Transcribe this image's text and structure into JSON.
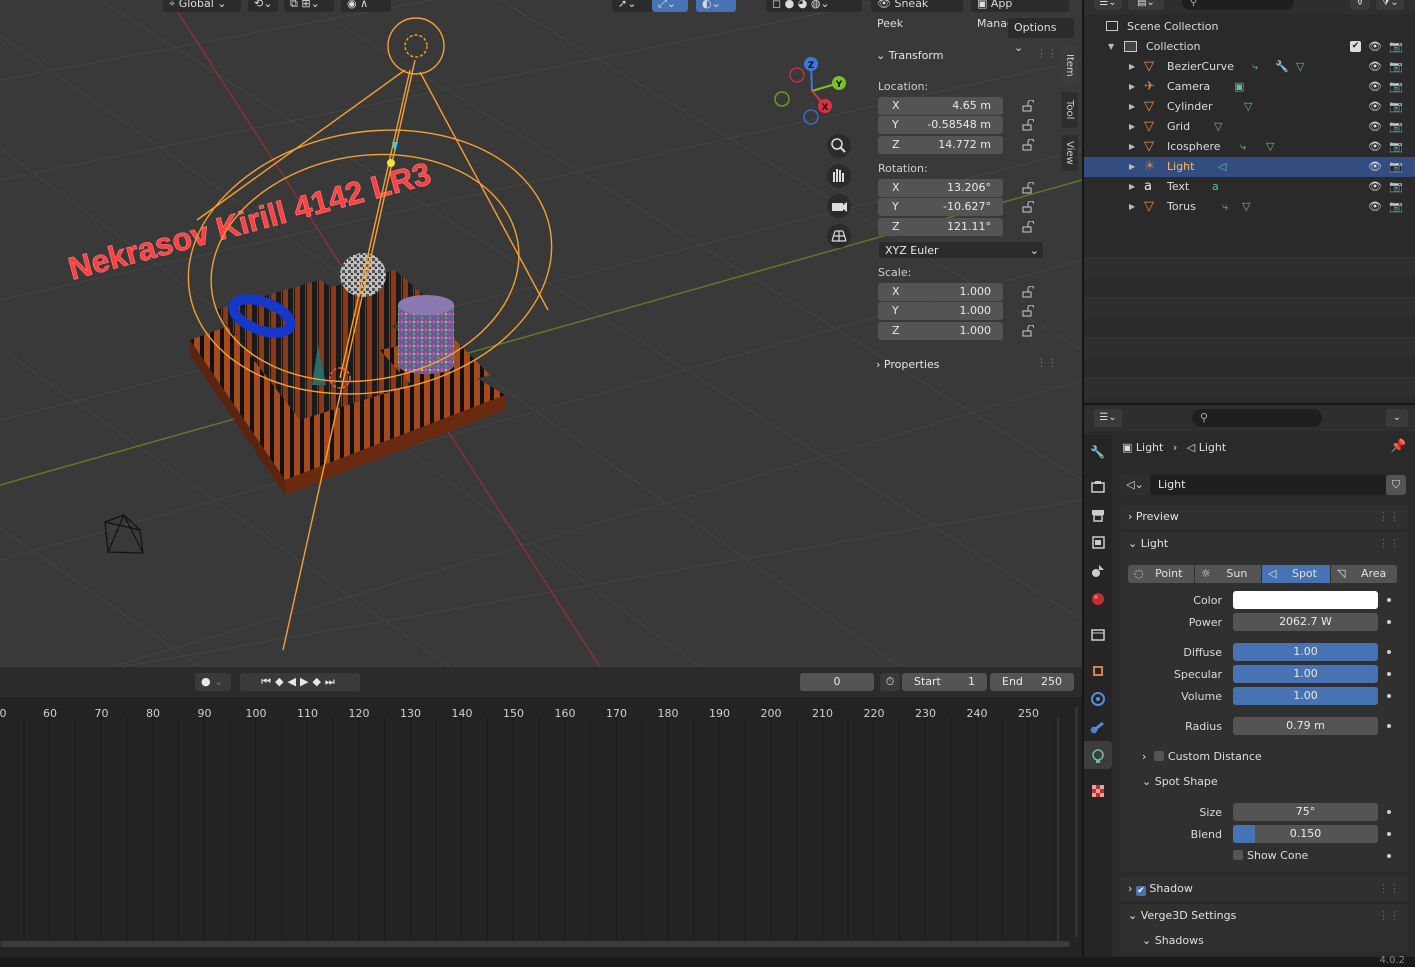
{
  "viewport": {
    "header": {
      "orientation": "Global",
      "sneak_peek": "Sneak Peek",
      "app_manager": "App Manager",
      "options": "Options"
    },
    "scene_text": "Nekrasov Kirill 4142 LR3",
    "gizmo": {
      "x": "X",
      "y": "Y",
      "z": "Z"
    },
    "sidebar_tabs": [
      "Item",
      "Tool",
      "View"
    ],
    "transform": {
      "title": "Transform",
      "location_label": "Location:",
      "location": [
        {
          "axis": "X",
          "value": "4.65 m"
        },
        {
          "axis": "Y",
          "value": "-0.58548 m"
        },
        {
          "axis": "Z",
          "value": "14.772 m"
        }
      ],
      "rotation_label": "Rotation:",
      "rotation": [
        {
          "axis": "X",
          "value": "13.206°"
        },
        {
          "axis": "Y",
          "value": "-10.627°"
        },
        {
          "axis": "Z",
          "value": "121.11°"
        }
      ],
      "rotation_mode": "XYZ Euler",
      "scale_label": "Scale:",
      "scale": [
        {
          "axis": "X",
          "value": "1.000"
        },
        {
          "axis": "Y",
          "value": "1.000"
        },
        {
          "axis": "Z",
          "value": "1.000"
        }
      ]
    },
    "properties_title": "Properties"
  },
  "timeline": {
    "current_frame": "0",
    "start_label": "Start",
    "start": "1",
    "end_label": "End",
    "end": "250",
    "ruler": [
      "0",
      "60",
      "70",
      "80",
      "90",
      "100",
      "110",
      "120",
      "130",
      "140",
      "150",
      "160",
      "170",
      "180",
      "190",
      "200",
      "210",
      "220",
      "230",
      "240",
      "250"
    ]
  },
  "outliner": {
    "scene_collection": "Scene Collection",
    "collection": "Collection",
    "items": [
      {
        "name": "BezierCurve"
      },
      {
        "name": "Camera"
      },
      {
        "name": "Cylinder"
      },
      {
        "name": "Grid"
      },
      {
        "name": "Icosphere"
      },
      {
        "name": "Light"
      },
      {
        "name": "Text"
      },
      {
        "name": "Torus"
      }
    ],
    "selected": "Light"
  },
  "properties": {
    "breadcrumb": [
      "Light",
      "Light"
    ],
    "datablock": "Light",
    "preview": "Preview",
    "light_section": "Light",
    "light_types": [
      "Point",
      "Sun",
      "Spot",
      "Area"
    ],
    "active_type": "Spot",
    "color_label": "Color",
    "color_value": "#ffffff",
    "power_label": "Power",
    "power": "2062.7 W",
    "diffuse_label": "Diffuse",
    "diffuse": "1.00",
    "specular_label": "Specular",
    "specular": "1.00",
    "volume_label": "Volume",
    "volume": "1.00",
    "radius_label": "Radius",
    "radius": "0.79 m",
    "custom_distance": "Custom Distance",
    "spot_shape": "Spot Shape",
    "size_label": "Size",
    "size": "75°",
    "blend_label": "Blend",
    "blend": "0.150",
    "blend_fraction": 0.15,
    "show_cone": "Show Cone",
    "shadow": "Shadow",
    "verge3d": "Verge3D Settings",
    "shadows": "Shadows"
  },
  "status": {
    "version": "4.0.2"
  },
  "colors": {
    "accent": "#4772b3",
    "selection": "#334d80",
    "light_orange": "#f5a030",
    "text_red": "#ff3a3a"
  }
}
